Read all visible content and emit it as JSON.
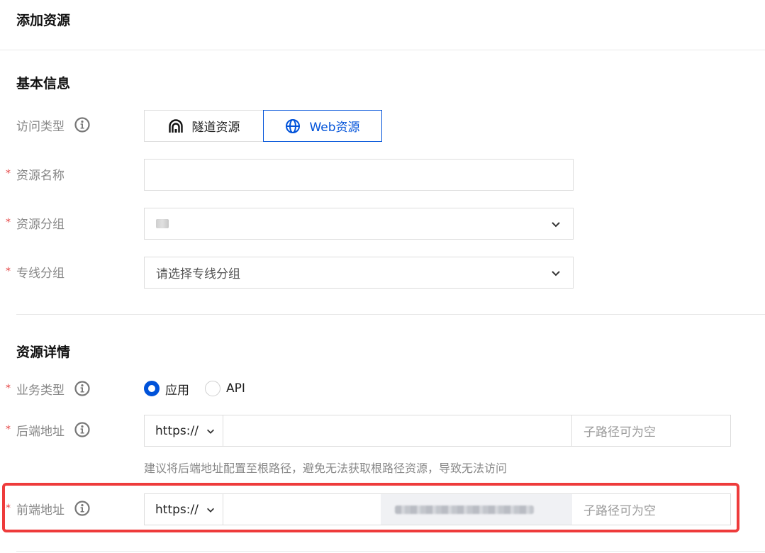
{
  "page": {
    "title": "添加资源"
  },
  "basic": {
    "title": "基本信息",
    "access_type": {
      "label": "访问类型",
      "options": [
        {
          "label": "隧道资源",
          "icon": "tunnel-icon",
          "selected": false
        },
        {
          "label": "Web资源",
          "icon": "globe-icon",
          "selected": true
        }
      ]
    },
    "resource_name": {
      "label": "资源名称",
      "required": true,
      "value": ""
    },
    "resource_group": {
      "label": "资源分组",
      "required": true,
      "value": ""
    },
    "line_group": {
      "label": "专线分组",
      "required": true,
      "placeholder": "请选择专线分组"
    }
  },
  "details": {
    "title": "资源详情",
    "business_type": {
      "label": "业务类型",
      "required": true,
      "options": [
        {
          "label": "应用",
          "selected": true
        },
        {
          "label": "API",
          "selected": false
        }
      ]
    },
    "backend": {
      "label": "后端地址",
      "required": true,
      "protocol": "https://",
      "host": "",
      "path_placeholder": "子路径可为空",
      "hint": "建议将后端地址配置至根路径，避免无法获取根路径资源，导致无法访问"
    },
    "frontend": {
      "label": "前端地址",
      "required": true,
      "protocol": "https://",
      "host": "",
      "path_placeholder": "子路径可为空"
    }
  },
  "colors": {
    "primary": "#0052d9",
    "required": "#e54545",
    "highlight": "#ee3b3b",
    "label": "#888888",
    "border": "#dcdcdc"
  }
}
